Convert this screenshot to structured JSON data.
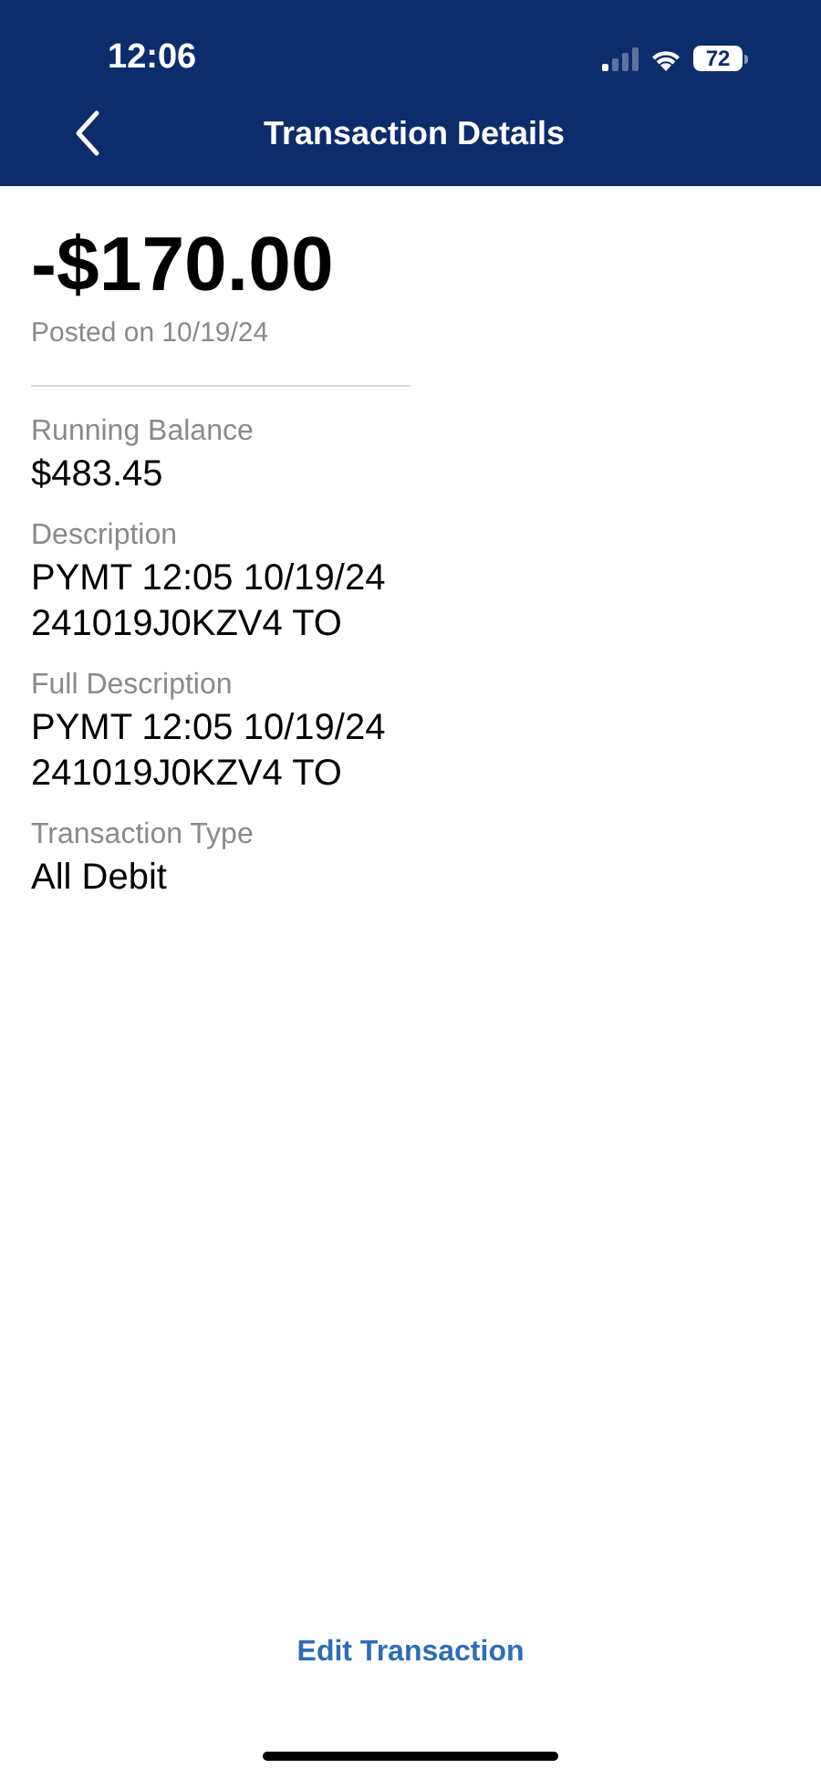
{
  "status_bar": {
    "time": "12:06",
    "battery": "72"
  },
  "header": {
    "title": "Transaction Details"
  },
  "summary": {
    "amount": "-$170.00",
    "posted": "Posted on 10/19/24"
  },
  "fields": [
    {
      "label": "Running Balance",
      "lines": [
        "$483.45"
      ]
    },
    {
      "label": "Description",
      "lines": [
        "PYMT 12:05 10/19/24",
        "241019J0KZV4 TO"
      ]
    },
    {
      "label": "Full Description",
      "lines": [
        "PYMT 12:05 10/19/24",
        "241019J0KZV4 TO"
      ]
    },
    {
      "label": "Transaction Type",
      "lines": [
        "All Debit"
      ]
    }
  ],
  "footer": {
    "link": "Edit Transaction"
  }
}
